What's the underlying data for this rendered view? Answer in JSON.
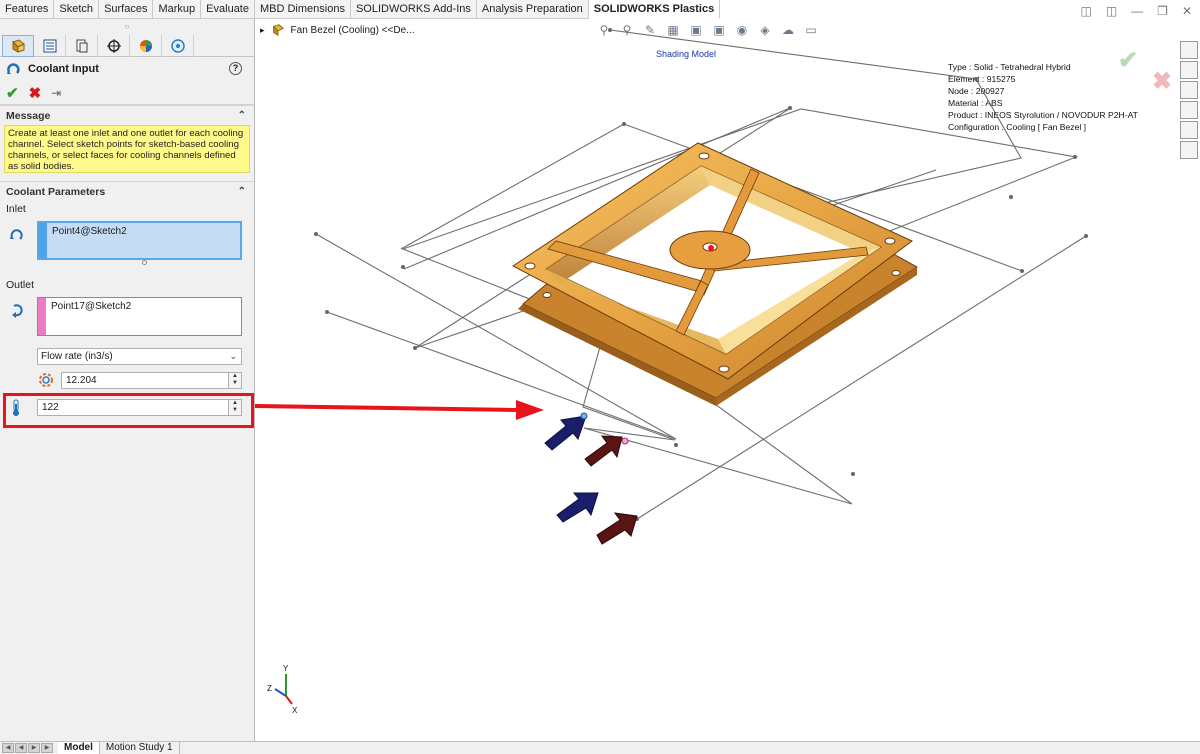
{
  "command_tabs": [
    "Features",
    "Sketch",
    "Surfaces",
    "Markup",
    "Evaluate",
    "MBD Dimensions",
    "SOLIDWORKS Add-Ins",
    "Analysis Preparation",
    "SOLIDWORKS Plastics"
  ],
  "active_command_tab": "SOLIDWORKS Plastics",
  "property_manager": {
    "title": "Coolant Input",
    "help_glyph": "?",
    "message_header": "Message",
    "message_text": "Create at least one inlet and one outlet for each cooling channel. Select sketch points for sketch-based cooling channels, or select faces for cooling channels defined as solid bodies.",
    "params_header": "Coolant Parameters",
    "inlet_label": "Inlet",
    "inlet_value": "Point4@Sketch2",
    "outlet_label": "Outlet",
    "outlet_value": "Point17@Sketch2",
    "flow_mode": "Flow rate (in3/s)",
    "flow_value": "12.204",
    "temperature_value": "122"
  },
  "graphics": {
    "document_title": "Fan Bezel (Cooling) <<De...",
    "shading_label": "Shading Model",
    "info_lines": [
      "Type : Solid - Tetrahedral Hybrid",
      "Element : 915275",
      "Node : 200927",
      "Material : ABS",
      "Product : INEOS Styrolution / NOVODUR P2H-AT",
      "Configuration : Cooling [ Fan Bezel ]"
    ],
    "triad_labels": {
      "x": "X",
      "y": "Y",
      "z": "Z"
    }
  },
  "bottom_tabs": [
    "Model",
    "Motion Study 1"
  ],
  "active_bottom_tab": "Model",
  "colors": {
    "accent_red": "#e8131b",
    "inlet_blue": "#4fa3e6",
    "outlet_pink": "#ea7cc1",
    "part_orange": "#e8a646",
    "inlet_arrow": "#1b1e6b",
    "outlet_arrow": "#5a1414",
    "message_yellow": "#fff98a"
  },
  "icons": [
    "feature-manager-icon",
    "property-manager-icon",
    "config-manager-icon",
    "dim-expert-icon",
    "display-manager-icon",
    "plastics-manager-icon",
    "coolant-input-icon",
    "ok-check-icon",
    "cancel-x-icon",
    "pushpin-icon",
    "help-icon",
    "inlet-selection-icon",
    "outlet-selection-icon",
    "flow-rate-icon",
    "temperature-icon"
  ]
}
